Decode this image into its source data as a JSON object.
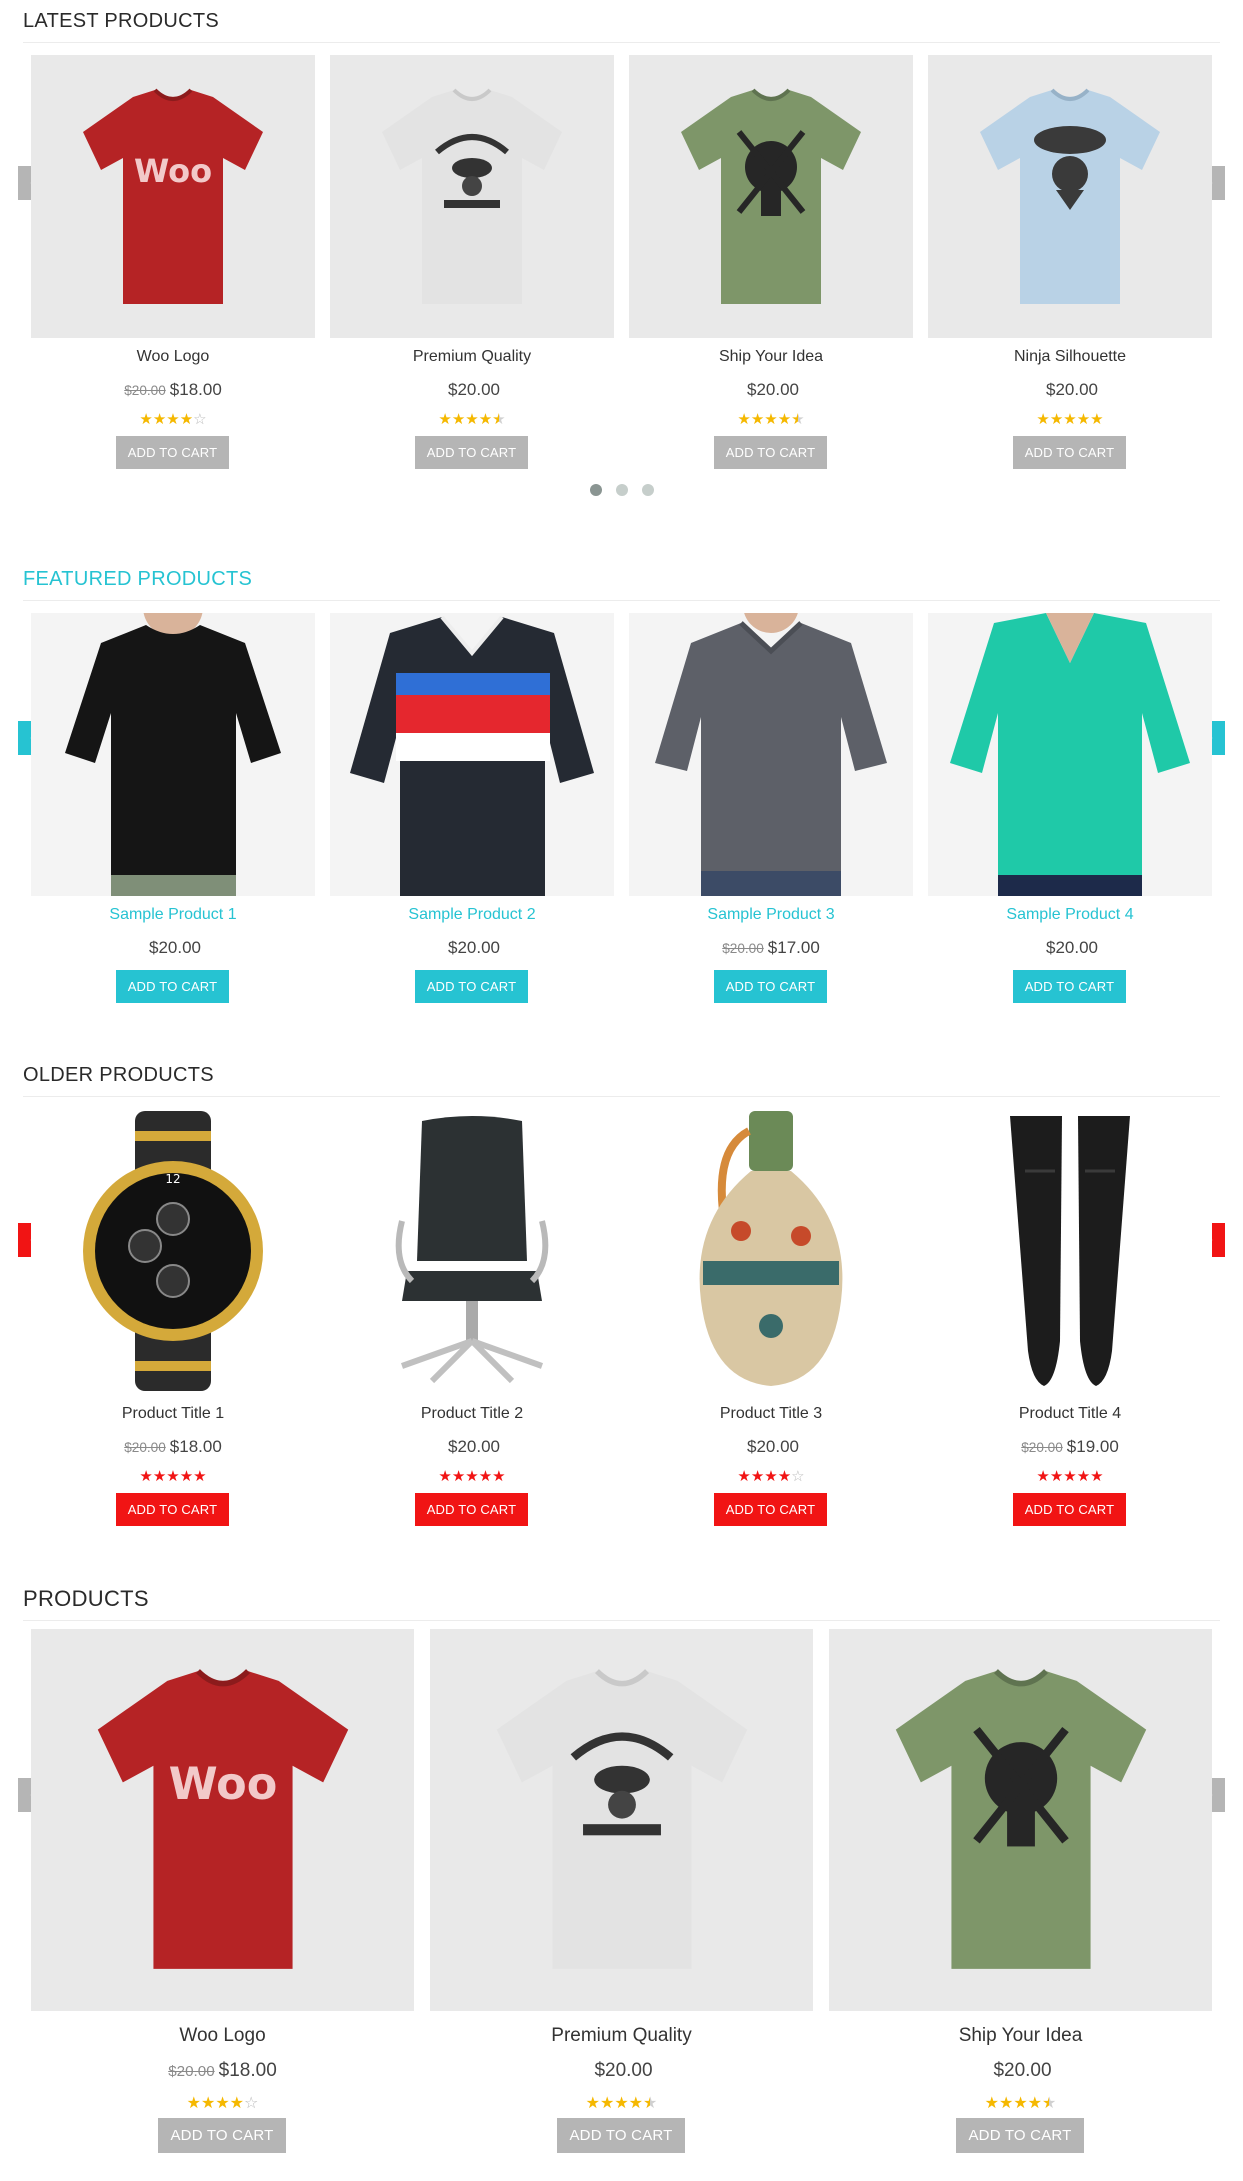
{
  "colors": {
    "grey_btn": "#b5b5b5",
    "teal": "#26c3d2",
    "red": "#f11414",
    "star_yellow": "#f5b800",
    "star_red": "#f11414"
  },
  "latest": {
    "title": "LATEST PRODUCTS",
    "products": [
      {
        "name": "Woo Logo",
        "old_price": "$20.00",
        "price": "$18.00",
        "rating": 4,
        "button": "ADD TO CART",
        "image": "red-tshirt-woo"
      },
      {
        "name": "Premium Quality",
        "old_price": "",
        "price": "$20.00",
        "rating": 4.5,
        "button": "ADD TO CART",
        "image": "white-tshirt-woothemes"
      },
      {
        "name": "Ship Your Idea",
        "old_price": "",
        "price": "$20.00",
        "rating": 4.5,
        "button": "ADD TO CART",
        "image": "green-tshirt-idea"
      },
      {
        "name": "Ninja Silhouette",
        "old_price": "",
        "price": "$20.00",
        "rating": 5,
        "button": "ADD TO CART",
        "image": "blue-tshirt-ninja"
      }
    ],
    "pagination": {
      "pages": 3,
      "active": 1
    }
  },
  "featured": {
    "title": "FEATURED PRODUCTS",
    "products": [
      {
        "name": "Sample Product 1",
        "old_price": "",
        "price": "$20.00",
        "button": "ADD TO CART",
        "image": "black-tshirt-model"
      },
      {
        "name": "Sample Product 2",
        "old_price": "",
        "price": "$20.00",
        "button": "ADD TO CART",
        "image": "striped-polo-model"
      },
      {
        "name": "Sample Product 3",
        "old_price": "$20.00",
        "price": "$17.00",
        "button": "ADD TO CART",
        "image": "grey-polo-model"
      },
      {
        "name": "Sample Product 4",
        "old_price": "",
        "price": "$20.00",
        "button": "ADD TO CART",
        "image": "teal-vneck-model"
      }
    ]
  },
  "older": {
    "title": "OLDER PRODUCTS",
    "products": [
      {
        "name": "Product Title 1",
        "old_price": "$20.00",
        "price": "$18.00",
        "rating": 5,
        "button": "ADD TO CART",
        "image": "gold-watch"
      },
      {
        "name": "Product Title 2",
        "old_price": "",
        "price": "$20.00",
        "rating": 5,
        "button": "ADD TO CART",
        "image": "office-chair"
      },
      {
        "name": "Product Title 3",
        "old_price": "",
        "price": "$20.00",
        "rating": 4,
        "button": "ADD TO CART",
        "image": "painted-vase"
      },
      {
        "name": "Product Title 4",
        "old_price": "$20.00",
        "price": "$19.00",
        "rating": 5,
        "button": "ADD TO CART",
        "image": "black-boots"
      }
    ]
  },
  "products": {
    "title": "PRODUCTS",
    "products": [
      {
        "name": "Woo Logo",
        "old_price": "$20.00",
        "price": "$18.00",
        "rating": 4,
        "button": "ADD TO CART",
        "image": "red-tshirt-woo"
      },
      {
        "name": "Premium Quality",
        "old_price": "",
        "price": "$20.00",
        "rating": 4.5,
        "button": "ADD TO CART",
        "image": "white-tshirt-woothemes"
      },
      {
        "name": "Ship Your Idea",
        "old_price": "",
        "price": "$20.00",
        "rating": 4.5,
        "button": "ADD TO CART",
        "image": "green-tshirt-idea"
      }
    ]
  }
}
